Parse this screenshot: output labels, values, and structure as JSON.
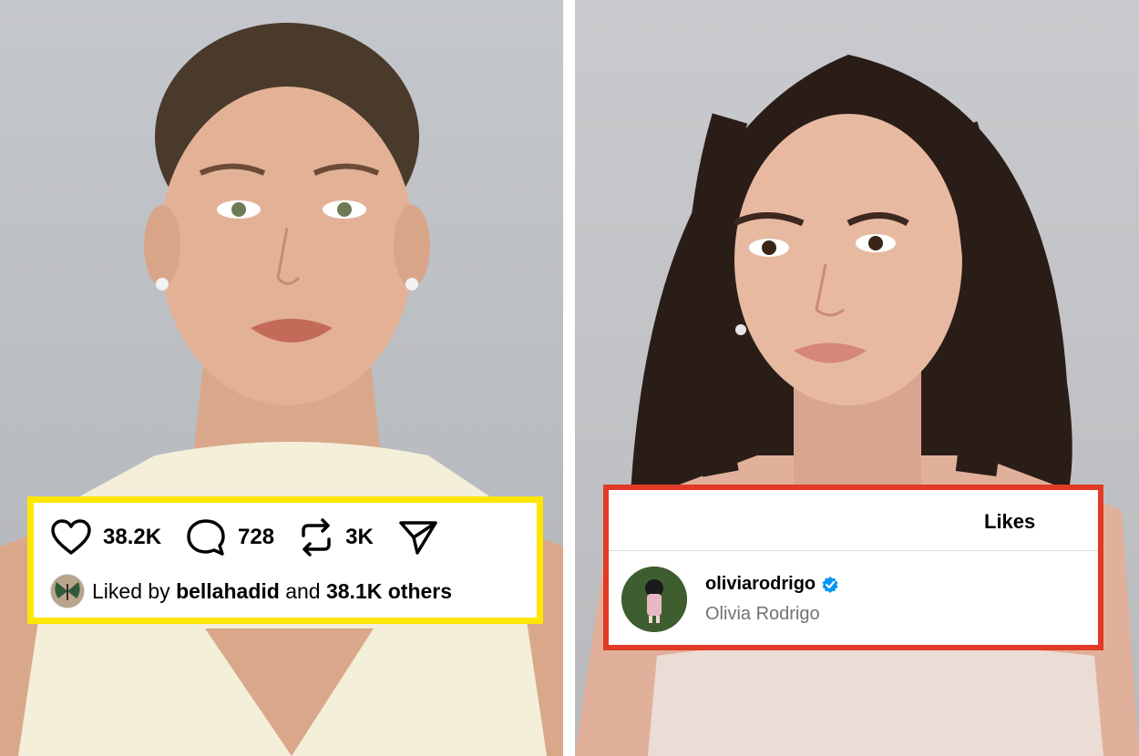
{
  "left_card": {
    "likes_count": "38.2K",
    "comments_count": "728",
    "reposts_count": "3K",
    "liked_by_prefix": "Liked by",
    "liked_by_user": "bellahadid",
    "liked_by_and": "and",
    "liked_by_others": "38.1K others"
  },
  "right_card": {
    "title": "Likes",
    "user": {
      "username": "oliviarodrigo",
      "full_name": "Olivia Rodrigo",
      "verified": true
    }
  },
  "colors": {
    "left_highlight_border": "#ffe600",
    "right_highlight_border": "#e23a26",
    "verified_badge": "#0095f6"
  },
  "icons": [
    "heart-icon",
    "comment-icon",
    "repost-icon",
    "share-icon",
    "verified-badge-icon"
  ]
}
